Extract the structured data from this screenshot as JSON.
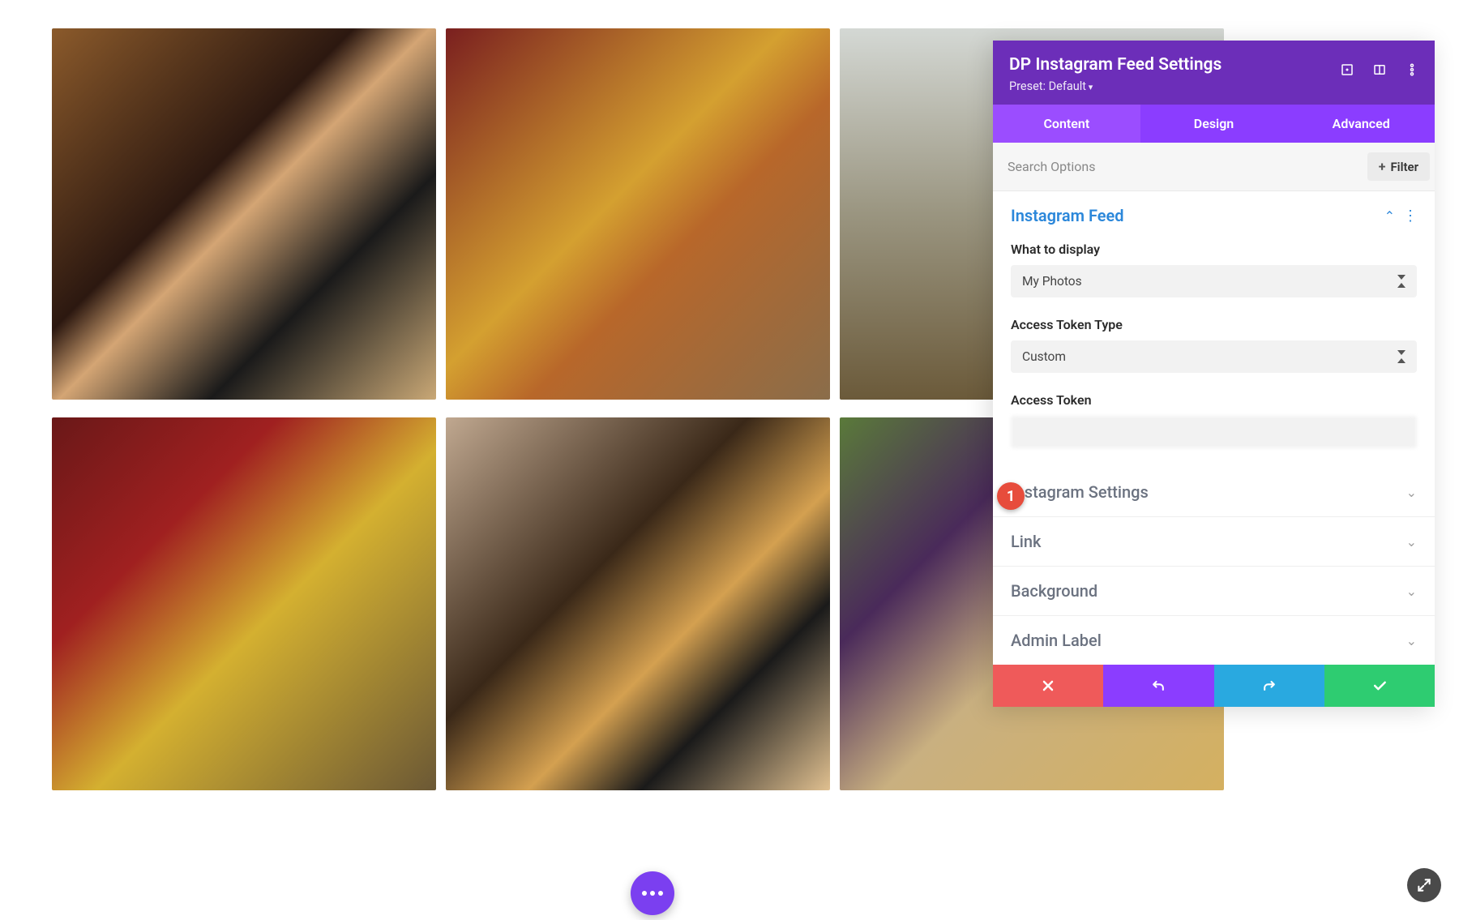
{
  "panel": {
    "title": "DP Instagram Feed Settings",
    "preset_label": "Preset: Default",
    "tabs": [
      "Content",
      "Design",
      "Advanced"
    ],
    "active_tab": 0,
    "search_placeholder": "Search Options",
    "filter_label": "Filter",
    "sections": {
      "instagram_feed": {
        "title": "Instagram Feed",
        "open": true,
        "fields": {
          "what_to_display": {
            "label": "What to display",
            "value": "My Photos"
          },
          "access_token_type": {
            "label": "Access Token Type",
            "value": "Custom"
          },
          "access_token": {
            "label": "Access Token",
            "value": ""
          }
        }
      },
      "instagram_settings": {
        "title": "Instagram Settings"
      },
      "link": {
        "title": "Link"
      },
      "background": {
        "title": "Background"
      },
      "admin_label": {
        "title": "Admin Label"
      }
    }
  },
  "callouts": {
    "token_marker": "1"
  },
  "colors": {
    "header": "#6c2eb9",
    "tabbar": "#8b3dff",
    "accent_blue": "#2b87da",
    "danger": "#ef5a5a",
    "success": "#2ecc71",
    "info": "#29a9e0"
  }
}
